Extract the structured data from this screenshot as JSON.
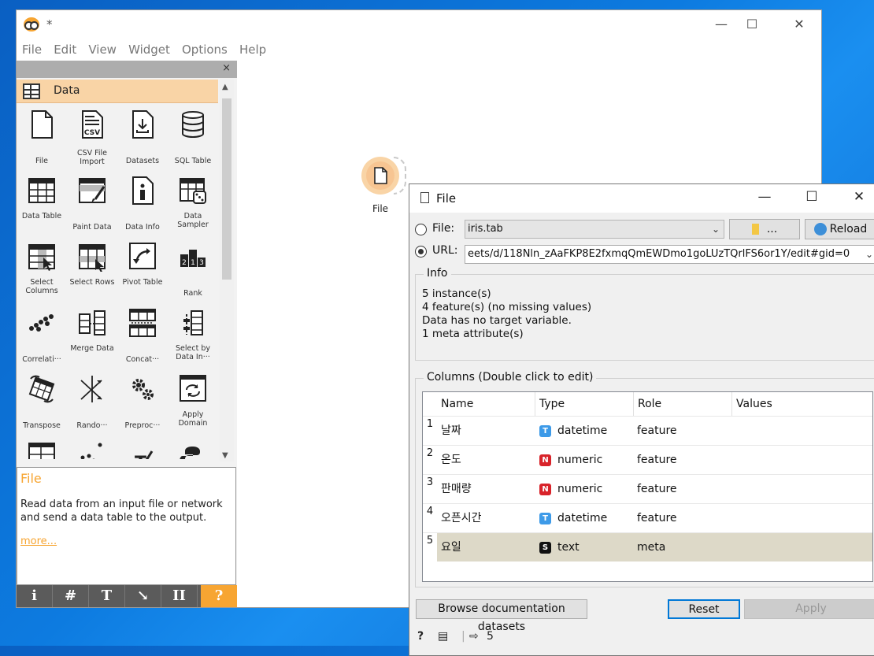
{
  "main_window": {
    "title": "*",
    "menu": [
      "File",
      "Edit",
      "View",
      "Widget",
      "Options",
      "Help"
    ]
  },
  "dock": {
    "close_glyph": "×",
    "category": "Data",
    "widgets": [
      {
        "label": "File",
        "icon": "file-icon"
      },
      {
        "label": "CSV File Import",
        "icon": "csv-icon"
      },
      {
        "label": "Datasets",
        "icon": "datasets-icon"
      },
      {
        "label": "SQL Table",
        "icon": "database-icon"
      },
      {
        "label": "Data Table",
        "icon": "table-icon"
      },
      {
        "label": "Paint Data",
        "icon": "paint-data-icon"
      },
      {
        "label": "Data Info",
        "icon": "info-icon"
      },
      {
        "label": "Data Sampler",
        "icon": "sampler-icon"
      },
      {
        "label": "Select Columns",
        "icon": "select-columns-icon"
      },
      {
        "label": "Select Rows",
        "icon": "select-rows-icon"
      },
      {
        "label": "Pivot Table",
        "icon": "pivot-icon"
      },
      {
        "label": "Rank",
        "icon": "rank-icon"
      },
      {
        "label": "Correlati···",
        "icon": "correlations-icon"
      },
      {
        "label": "Merge Data",
        "icon": "merge-icon"
      },
      {
        "label": "Concat···",
        "icon": "concatenate-icon"
      },
      {
        "label": "Select by Data In···",
        "icon": "select-by-index-icon"
      },
      {
        "label": "Transpose",
        "icon": "transpose-icon"
      },
      {
        "label": "Rando···",
        "icon": "randomize-icon"
      },
      {
        "label": "Preproc···",
        "icon": "preprocess-icon"
      },
      {
        "label": "Apply Domain",
        "icon": "apply-domain-icon"
      }
    ],
    "help": {
      "title": "File",
      "text": "Read data from an input file or network and send a data table to the output.",
      "more": "more..."
    },
    "toolbar": [
      "i",
      "#",
      "T",
      "↘",
      "II",
      "?"
    ]
  },
  "canvas": {
    "node_label": "File"
  },
  "dialog": {
    "title": "File",
    "file_label": "File:",
    "file_value": "iris.tab",
    "browse_label": "...",
    "reload_label": "Reload",
    "url_label": "URL:",
    "url_value": "eets/d/118Nln_zAaFKP8E2fxmqQmEWDmo1goLUzTQrlFS6or1Y/edit#gid=0",
    "info_title": "Info",
    "info_lines": [
      "5 instance(s)",
      "4 feature(s) (no missing values)",
      "Data has no target variable.",
      "1 meta attribute(s)"
    ],
    "columns_title": "Columns (Double click to edit)",
    "headers": [
      "Name",
      "Type",
      "Role",
      "Values"
    ],
    "rows": [
      {
        "n": "1",
        "name": "날짜",
        "badge": "T",
        "type": "datetime",
        "role": "feature",
        "values": "",
        "badge_color": "#3d9ae8"
      },
      {
        "n": "2",
        "name": "온도",
        "badge": "N",
        "type": "numeric",
        "role": "feature",
        "values": "",
        "badge_color": "#d8232a"
      },
      {
        "n": "3",
        "name": "판매량",
        "badge": "N",
        "type": "numeric",
        "role": "feature",
        "values": "",
        "badge_color": "#d8232a"
      },
      {
        "n": "4",
        "name": "오픈시간",
        "badge": "T",
        "type": "datetime",
        "role": "feature",
        "values": "",
        "badge_color": "#3d9ae8"
      },
      {
        "n": "5",
        "name": "요일",
        "badge": "S",
        "type": "text",
        "role": "meta",
        "values": "",
        "badge_color": "#111111"
      }
    ],
    "browse_docs": "Browse documentation datasets",
    "reset": "Reset",
    "apply": "Apply",
    "output_count": "5"
  }
}
